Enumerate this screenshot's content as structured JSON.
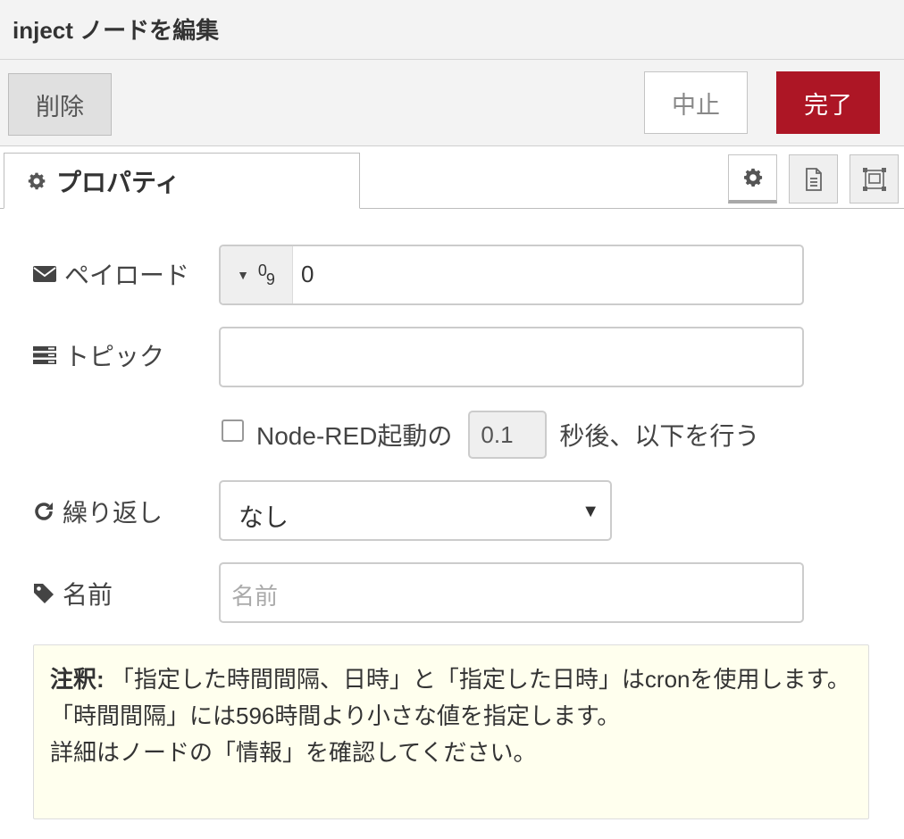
{
  "header": {
    "title": "inject ノードを編集"
  },
  "toolbar": {
    "delete_label": "削除",
    "cancel_label": "中止",
    "done_label": "完了"
  },
  "tabs": {
    "properties_label": "プロパティ"
  },
  "side_tabs": [
    {
      "icon": "gear-icon",
      "active": true
    },
    {
      "icon": "document-icon",
      "active": false
    },
    {
      "icon": "appearance-icon",
      "active": false
    }
  ],
  "form": {
    "payload": {
      "label": "ペイロード",
      "type_label": "0 9",
      "value": "0"
    },
    "topic": {
      "label": "トピック",
      "value": ""
    },
    "once": {
      "checkbox_label": "Node-RED起動の",
      "delay_value": "0.1",
      "suffix": "秒後、以下を行う",
      "checked": false
    },
    "repeat": {
      "label": "繰り返し",
      "selected": "なし"
    },
    "name": {
      "label": "名前",
      "placeholder": "名前",
      "value": ""
    }
  },
  "note": {
    "prefix": "注釈:",
    "line1": "「指定した時間間隔、日時」と「指定した日時」はcronを使用します。",
    "line2": "「時間間隔」には596時間より小さな値を指定します。",
    "line3": "詳細はノードの「情報」を確認してください。"
  },
  "colors": {
    "accent": "#ad1625",
    "note_bg": "#ffffee",
    "toolbar_bg": "#f3f3f3"
  }
}
